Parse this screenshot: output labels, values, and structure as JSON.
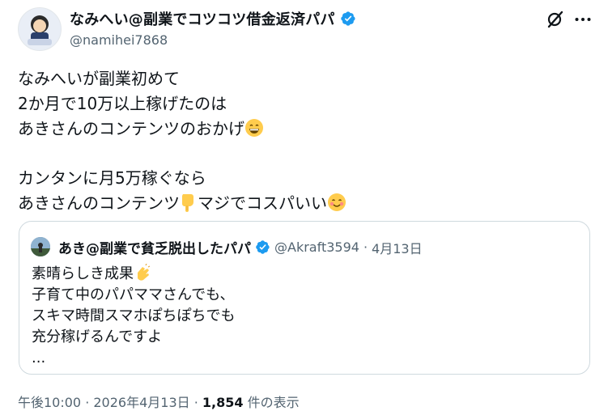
{
  "author": {
    "display_name": "なみへい@副業でコツコツ借金返済パパ",
    "handle": "@namihei7868"
  },
  "tweet": {
    "lines": [
      "なみへいが副業初めて",
      "2か月で10万以上稼げたのは",
      "あきさんのコンテンツのおかげ",
      "カンタンに月5万稼ぐなら",
      "あきさんのコンテンツ",
      "マジでコスパいい"
    ]
  },
  "quoted": {
    "display_name": "あき@副業で貧乏脱出したパパ",
    "handle": "@Akraft3594",
    "separator": "·",
    "date": "4月13日",
    "lines": [
      "素晴らしき成果",
      "子育て中のパパママさんでも、",
      "スキマ時間スマホぽちぽちでも",
      "充分稼げるんですよ",
      "..."
    ]
  },
  "footer": {
    "time": "午後10:00 · 2026年4月13日 ·",
    "views_count": "1,854",
    "views_label": "件の表示"
  },
  "colors": {
    "verified": "#1d9bf0",
    "text": "#0f1419",
    "secondary": "#536471",
    "border": "#cfd9de"
  },
  "icons": [
    "verified-badge-icon",
    "grok-icon",
    "more-icon",
    "grinning-emoji",
    "pointing-down-emoji",
    "smiling-emoji",
    "clapping-emoji"
  ]
}
